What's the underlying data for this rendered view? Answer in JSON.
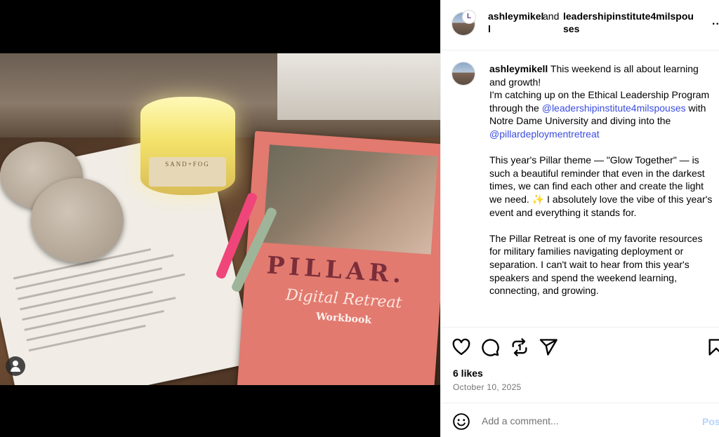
{
  "post": {
    "author": "ashleymikell",
    "connector": "and",
    "collaborator": "leadershipinstitute4milspouses",
    "more_label": "..."
  },
  "media": {
    "candle_label": "SAND+FOG",
    "book_title": "PILLAR.",
    "book_subtitle": "Digital Retreat",
    "book_label": "Workbook"
  },
  "caption": {
    "username": "ashleymikell",
    "intro": "This weekend is all about learning and growth!",
    "line2_pre": "I'm catching up on the Ethical Leadership Program through the",
    "mention1": "@leadershipinstitute4milspouses",
    "line2_mid": "with Notre Dame University and diving into the",
    "mention2": "@pillardeploymentretreat",
    "para2": "This year's Pillar theme — \"Glow Together\" — is such a beautiful reminder that even in the darkest times, we can find each other and create the light we need. ✨ I absolutely love the vibe of this year's event and everything it stands for.",
    "para3": "The Pillar Retreat is one of my favorite resources for military families navigating deployment or separation. I can't wait to hear from this year's speakers and spend the weekend learning, connecting, and growing."
  },
  "engagement": {
    "likes": "6 likes",
    "date": "October 10, 2025"
  },
  "comment": {
    "placeholder": "Add a comment...",
    "post_label": "Pos"
  }
}
